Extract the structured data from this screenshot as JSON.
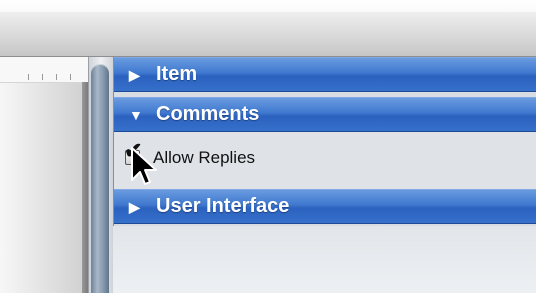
{
  "inspector": {
    "sections": [
      {
        "label": "Item",
        "expanded": false,
        "arrow": "▶"
      },
      {
        "label": "Comments",
        "expanded": true,
        "arrow": "▼"
      },
      {
        "label": "User Interface",
        "expanded": false,
        "arrow": "▶"
      }
    ],
    "comments": {
      "allow_replies_label": "Allow Replies",
      "allow_replies_checked": true
    }
  },
  "colors": {
    "section_header": "#3a72cc",
    "pane_background": "#d8dde3",
    "scroll_thumb": "#8397ad"
  },
  "icons": {
    "checkmark": "check-icon",
    "cursor": "mouse-pointer-icon"
  }
}
